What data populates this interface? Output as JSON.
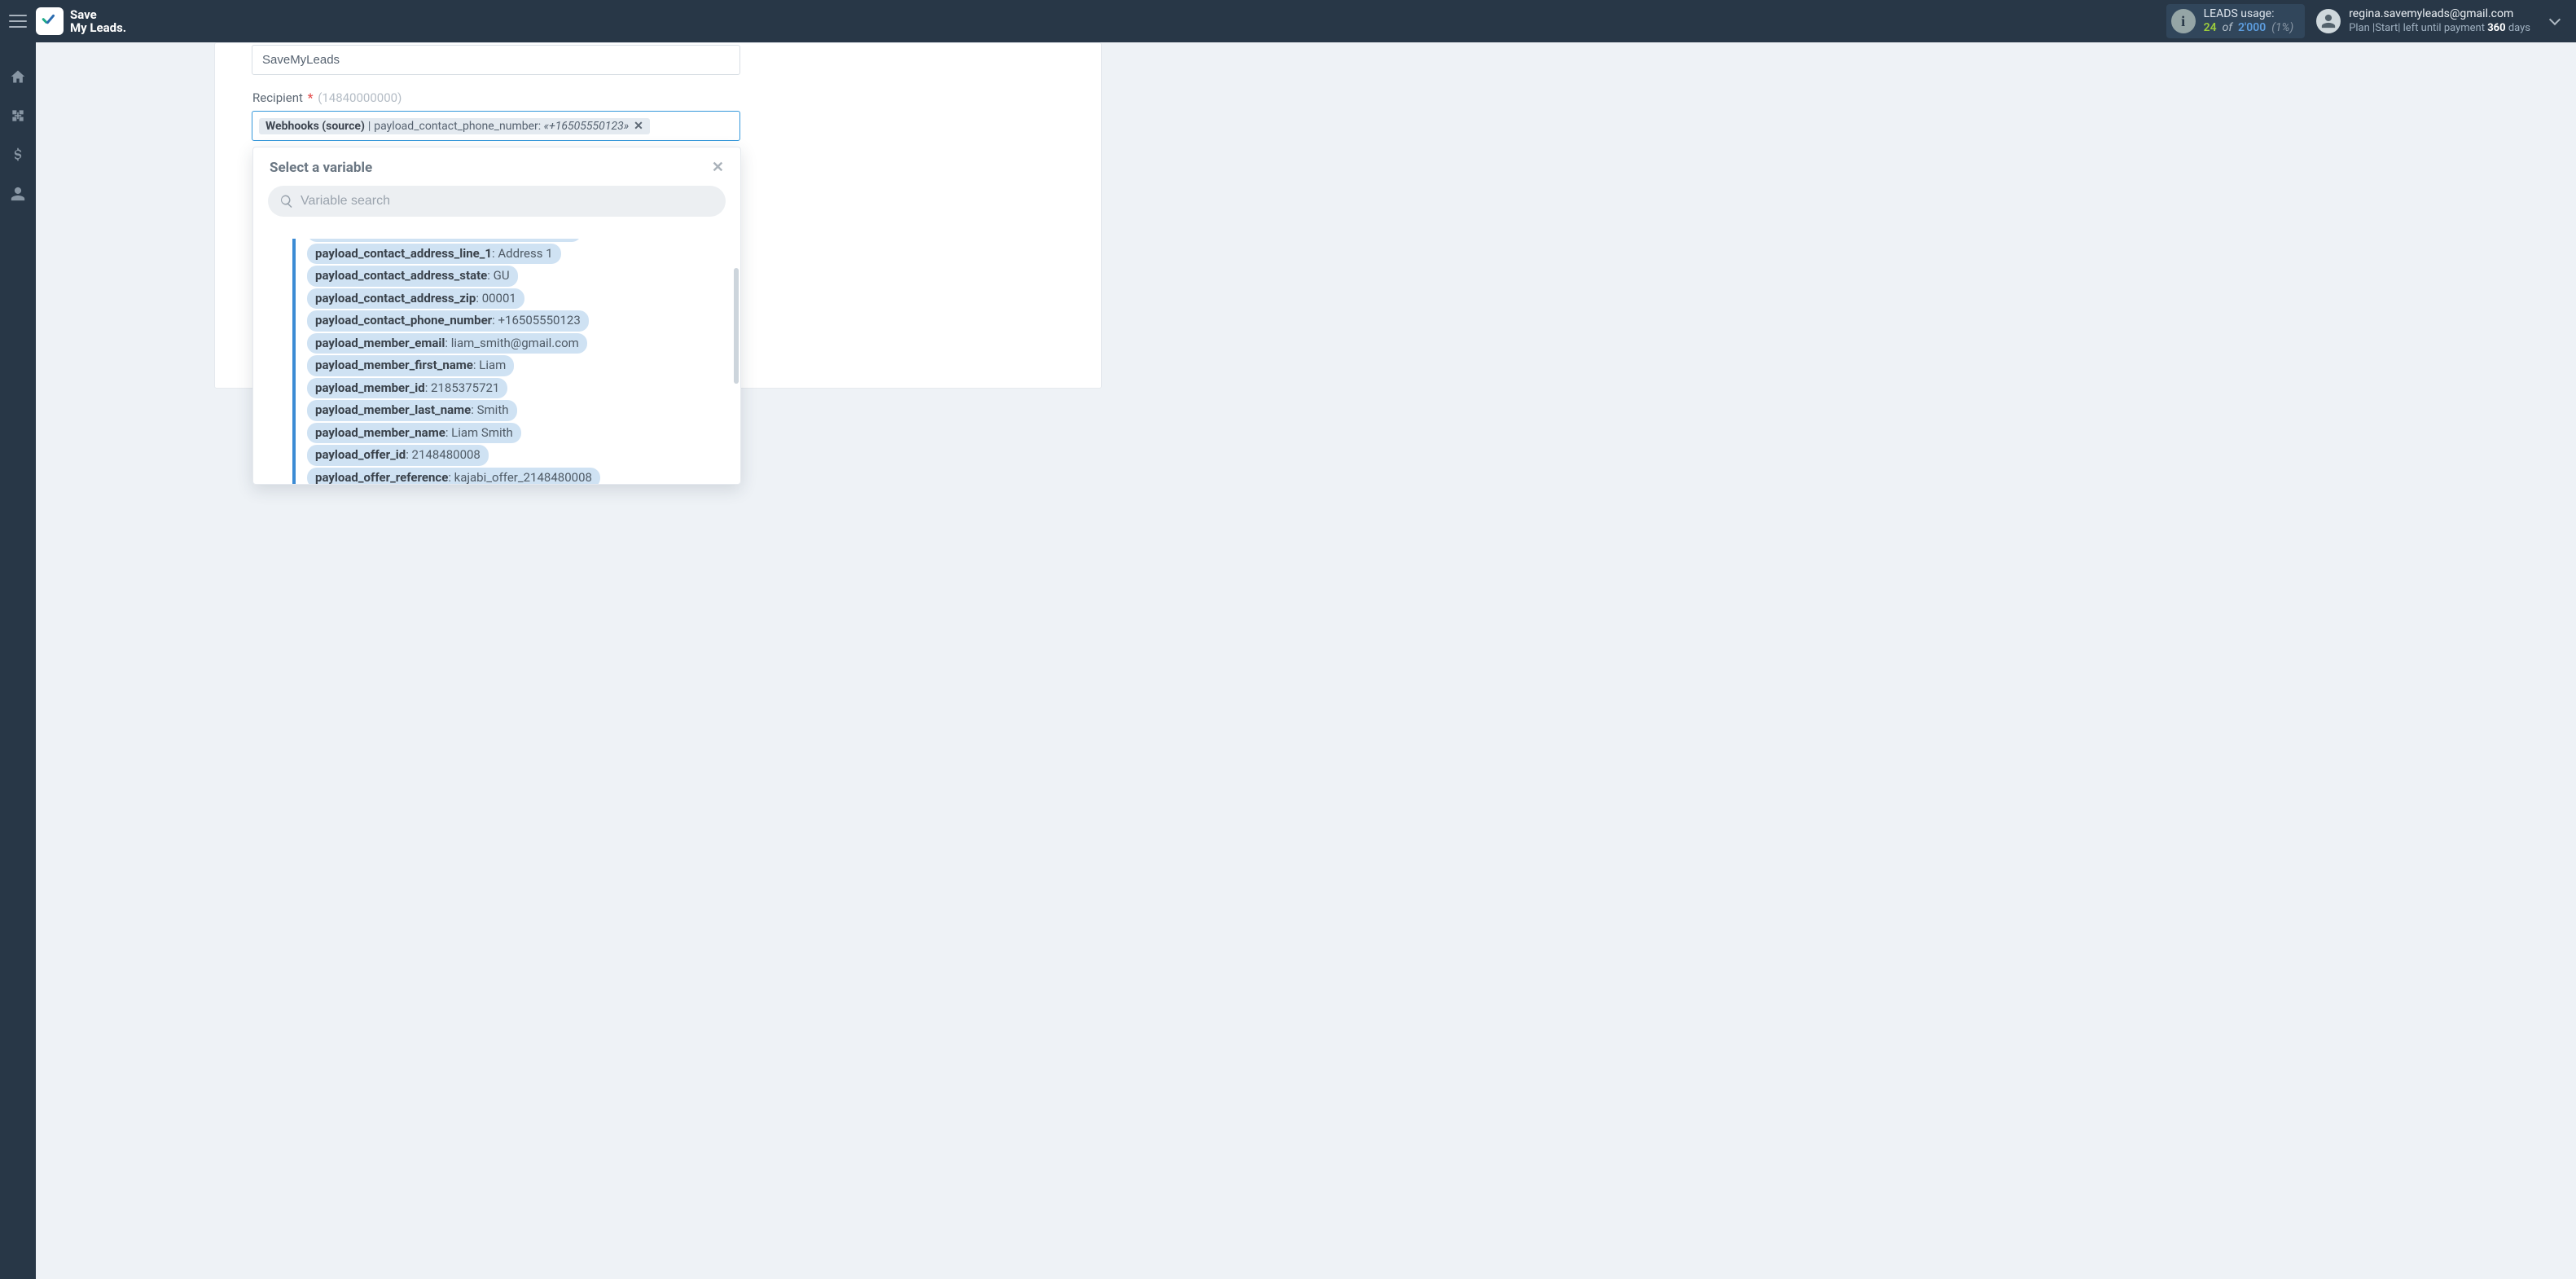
{
  "brand": {
    "line1": "Save",
    "line2": "My Leads."
  },
  "usage": {
    "label": "LEADS usage:",
    "used": "24",
    "of_word": "of",
    "total": "2'000",
    "pct": "(1%)"
  },
  "account": {
    "email": "regina.savemyleads@gmail.com",
    "plan_prefix": "Plan |Start| left until payment",
    "days_num": "360",
    "days_word": "days"
  },
  "form": {
    "name_value": "SaveMyLeads",
    "recipient_label": "Recipient",
    "recipient_hint": "(14840000000)"
  },
  "chip": {
    "source": "Webhooks (source)",
    "field": "payload_contact_phone_number:",
    "value": "«+16505550123»"
  },
  "dropdown": {
    "title": "Select a variable",
    "search_placeholder": "Variable search",
    "items": [
      {
        "key": "payload_contact_address_line_1",
        "val": "Address 1"
      },
      {
        "key": "payload_contact_address_state",
        "val": "GU"
      },
      {
        "key": "payload_contact_address_zip",
        "val": "00001"
      },
      {
        "key": "payload_contact_phone_number",
        "val": "+16505550123"
      },
      {
        "key": "payload_member_email",
        "val": "liam_smith@gmail.com"
      },
      {
        "key": "payload_member_first_name",
        "val": "Liam"
      },
      {
        "key": "payload_member_id",
        "val": "2185375721"
      },
      {
        "key": "payload_member_last_name",
        "val": "Smith"
      },
      {
        "key": "payload_member_name",
        "val": "Liam Smith"
      },
      {
        "key": "payload_offer_id",
        "val": "2148480008"
      },
      {
        "key": "payload_offer_reference",
        "val": "kajabi_offer_2148480008"
      }
    ]
  }
}
